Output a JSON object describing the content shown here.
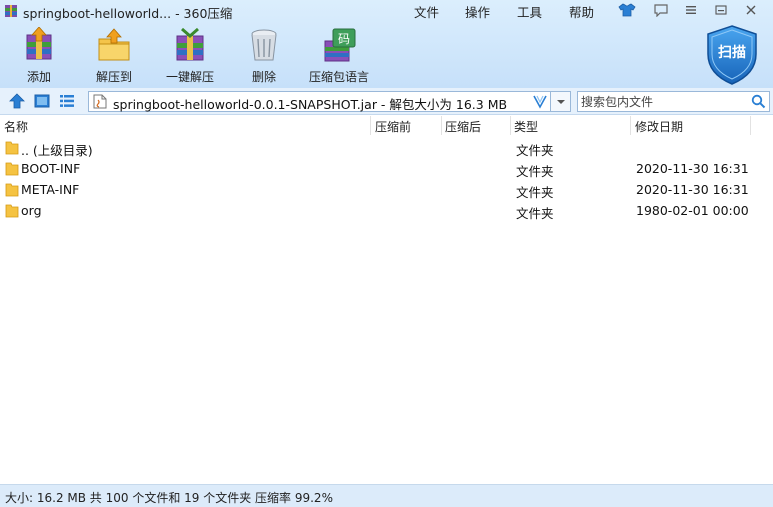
{
  "window": {
    "title": "springboot-helloworld... - 360压缩",
    "menu": [
      "文件",
      "操作",
      "工具",
      "帮助"
    ]
  },
  "toolbar": {
    "items": [
      {
        "label": "添加",
        "icon": "add-archive-icon"
      },
      {
        "label": "解压到",
        "icon": "extract-to-icon"
      },
      {
        "label": "一键解压",
        "icon": "one-click-extract-icon"
      },
      {
        "label": "删除",
        "icon": "delete-trash-icon"
      },
      {
        "label": "压缩包语言",
        "icon": "archive-language-icon"
      }
    ],
    "scan_label": "扫描",
    "scan_icon_text": "码"
  },
  "address": {
    "path": "springboot-helloworld-0.0.1-SNAPSHOT.jar - 解包大小为 16.3 MB",
    "search_placeholder": "搜索包内文件"
  },
  "columns": {
    "name": "名称",
    "before": "压缩前",
    "after": "压缩后",
    "type": "类型",
    "modified": "修改日期"
  },
  "files": [
    {
      "name": ".. (上级目录)",
      "before": "",
      "after": "",
      "type": "文件夹",
      "modified": ""
    },
    {
      "name": "BOOT-INF",
      "before": "",
      "after": "",
      "type": "文件夹",
      "modified": "2020-11-30 16:31"
    },
    {
      "name": "META-INF",
      "before": "",
      "after": "",
      "type": "文件夹",
      "modified": "2020-11-30 16:31"
    },
    {
      "name": "org",
      "before": "",
      "after": "",
      "type": "文件夹",
      "modified": "1980-02-01 00:00"
    }
  ],
  "status": {
    "text": "大小: 16.2 MB 共 100 个文件和 19 个文件夹 压缩率 99.2%"
  },
  "colors": {
    "chrome": "#cfe6fb",
    "folder": "#f5c342",
    "scan_shield": "#1f7fd6",
    "accent": "#2a7fd4"
  }
}
